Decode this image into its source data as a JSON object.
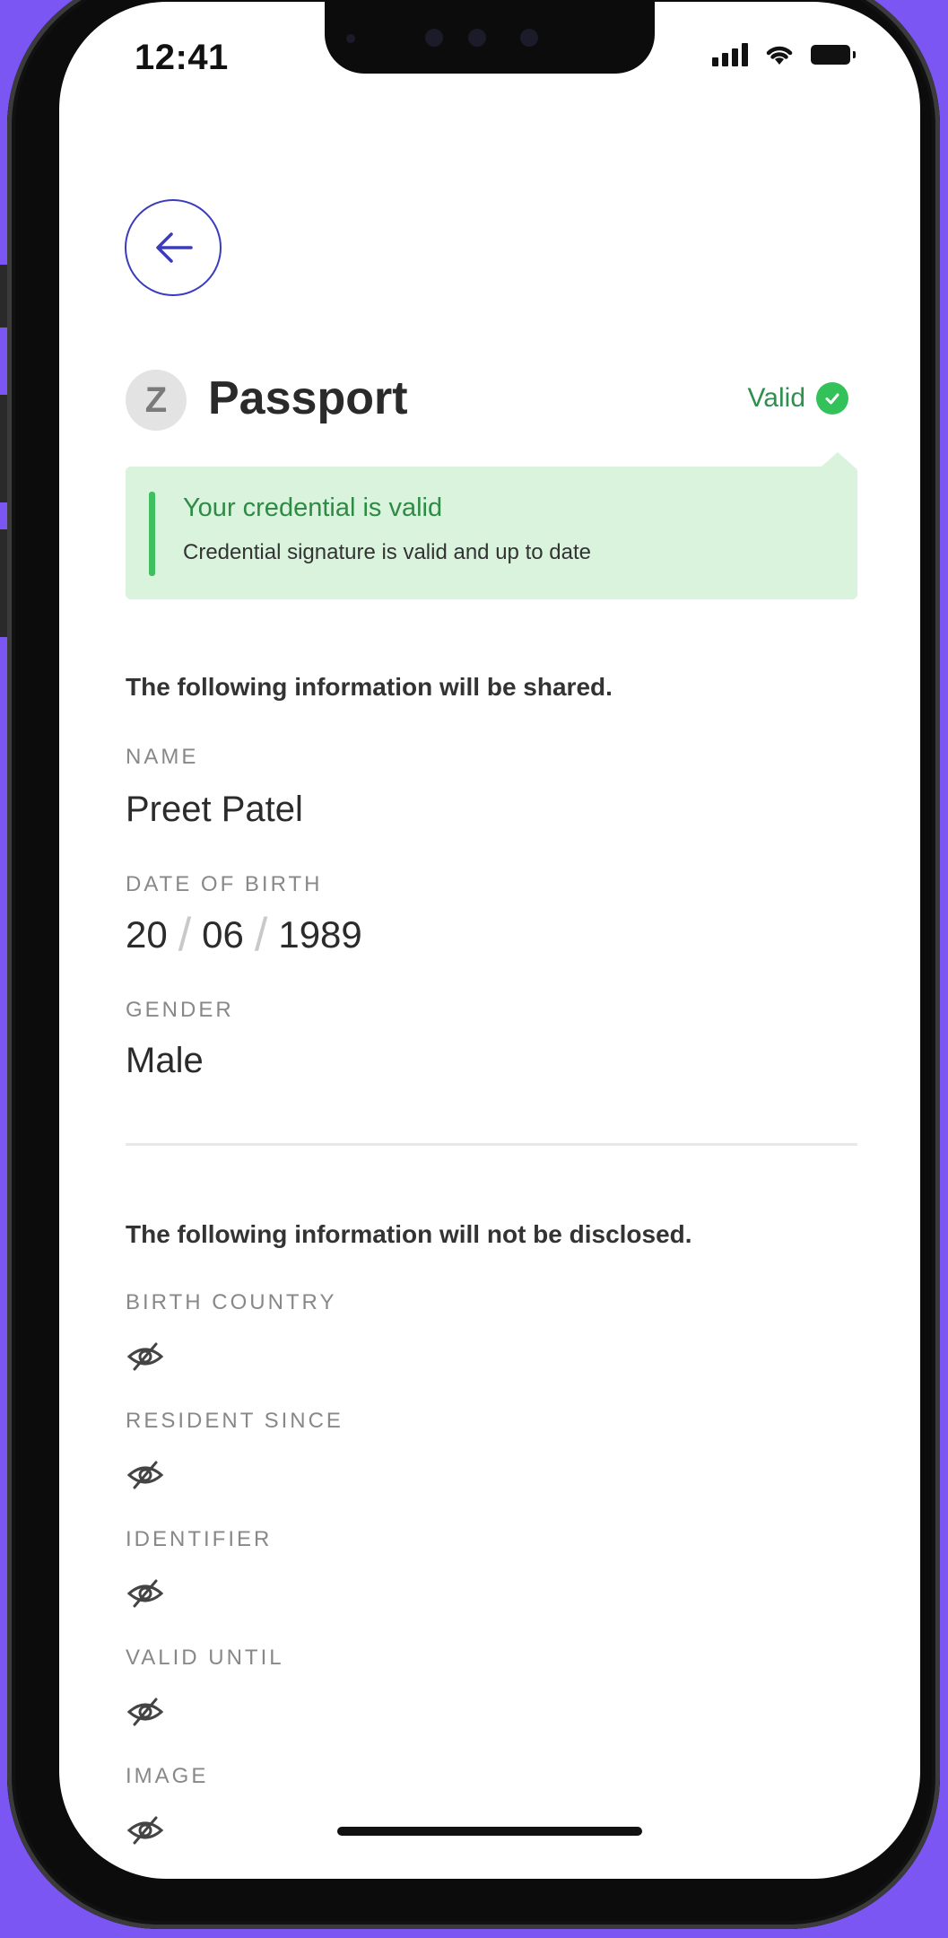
{
  "status_bar": {
    "time": "12:41"
  },
  "header": {
    "avatar_letter": "Z",
    "title": "Passport",
    "status_label": "Valid"
  },
  "alert": {
    "title": "Your credential is valid",
    "message": "Credential signature is valid and up to date"
  },
  "shared": {
    "heading": "The following information will be shared.",
    "name_label": "NAME",
    "name_value": "Preet Patel",
    "dob_label": "DATE OF BIRTH",
    "dob_day": "20",
    "dob_month": "06",
    "dob_year": "1989",
    "gender_label": "GENDER",
    "gender_value": "Male"
  },
  "hidden": {
    "heading": "The following information will not be disclosed.",
    "fields": [
      {
        "label": "BIRTH COUNTRY",
        "icon": "eye-off-icon"
      },
      {
        "label": "RESIDENT SINCE",
        "icon": "eye-off-icon"
      },
      {
        "label": "IDENTIFIER",
        "icon": "eye-off-icon"
      },
      {
        "label": "VALID UNTIL",
        "icon": "eye-off-icon"
      },
      {
        "label": "IMAGE",
        "icon": "eye-off-icon"
      }
    ]
  },
  "colors": {
    "background": "#7b56f2",
    "accent": "#3b3bbf",
    "valid_green": "#33c15a",
    "alert_bg": "#d9f3dd"
  }
}
